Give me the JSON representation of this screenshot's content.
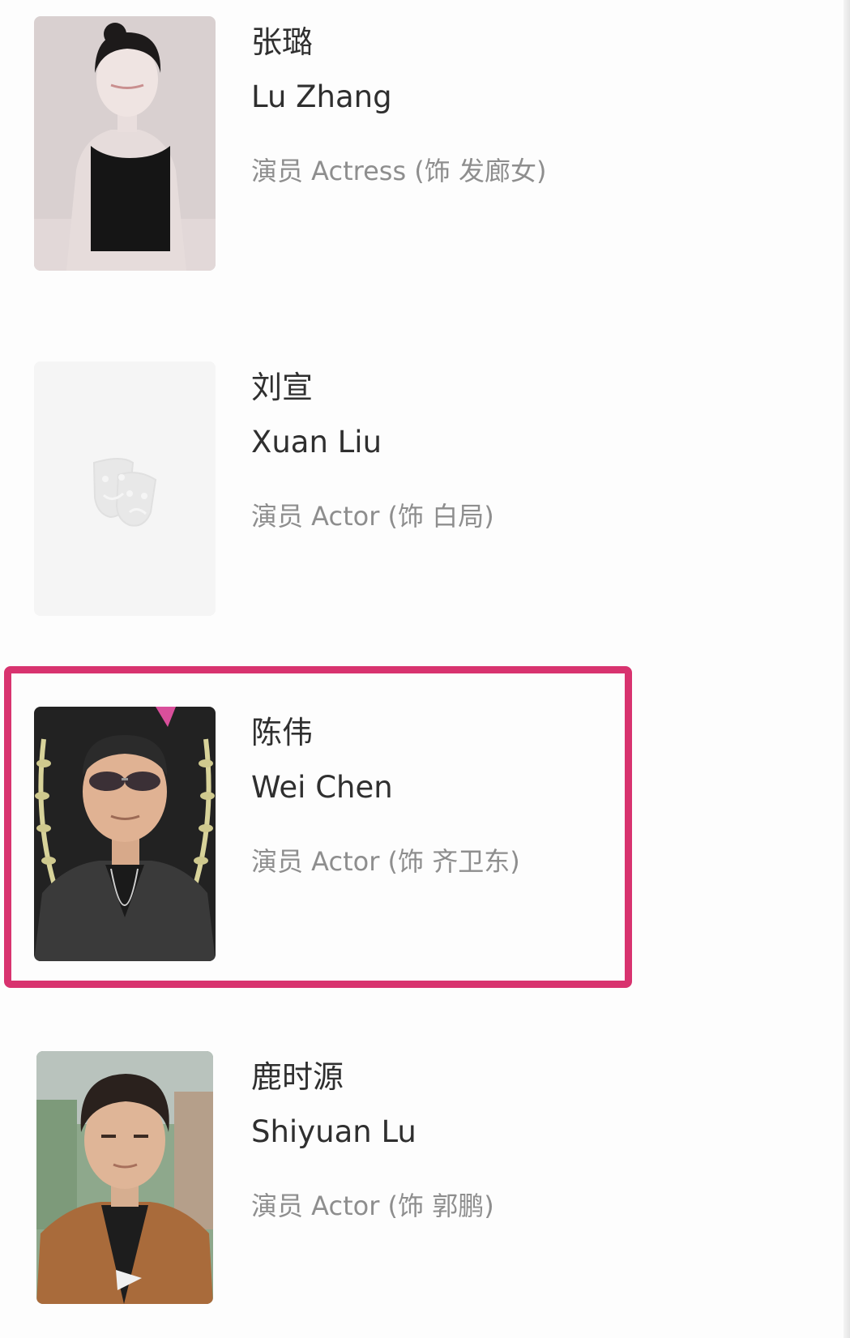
{
  "cast": [
    {
      "name_zh": "张璐",
      "name_en": "Lu Zhang",
      "role": "演员 Actress (饰 发廊女)",
      "photo_icon": "portrait-photo"
    },
    {
      "name_zh": "刘宣",
      "name_en": "Xuan Liu",
      "role": "演员 Actor (饰 白局)",
      "photo_icon": "theater-masks-icon"
    },
    {
      "name_zh": "陈伟",
      "name_en": "Wei Chen",
      "role": "演员 Actor (饰 齐卫东)",
      "photo_icon": "portrait-photo",
      "highlighted": true
    },
    {
      "name_zh": "鹿时源",
      "name_en": "Shiyuan Lu",
      "role": "演员 Actor (饰 郭鹏)",
      "photo_icon": "portrait-photo"
    }
  ],
  "colors": {
    "highlight_border": "#d8336f",
    "name_text": "#2f2f2f",
    "role_text": "#8e8e8e",
    "placeholder_bg": "#f5f5f5"
  }
}
